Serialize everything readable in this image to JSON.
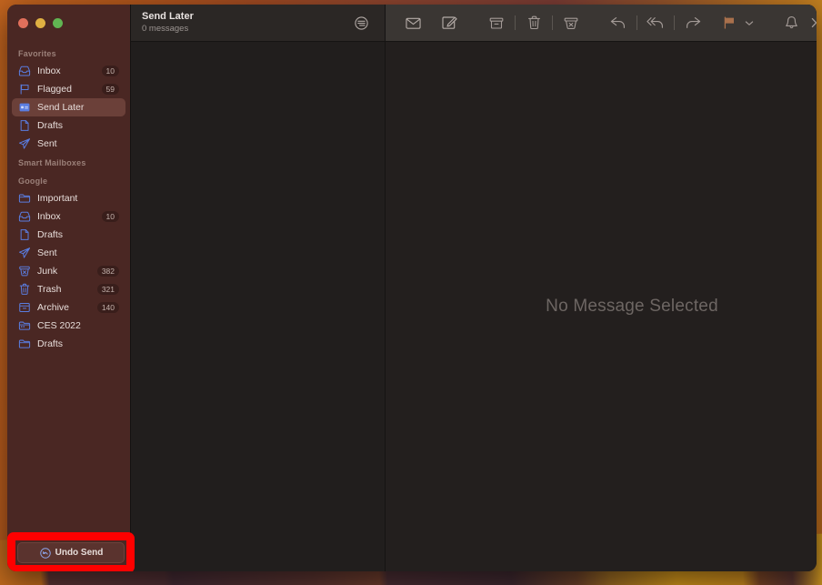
{
  "window": {
    "traffic_lights": [
      "close",
      "minimize",
      "maximize"
    ],
    "colors": {
      "sidebar_bg": "#4a2723",
      "selected_item_bg": "#6b4039",
      "toolbar_bg": "#3a3633",
      "content_bg": "#231f1e",
      "list_bg": "#211e1d",
      "accent_icon": "#5a7de0",
      "flag_orange": "#a9704c",
      "highlight_red": "#fe0000"
    }
  },
  "sidebar": {
    "sections": [
      {
        "header": "Favorites",
        "items": [
          {
            "label": "Inbox",
            "icon": "inbox-icon",
            "badge": "10",
            "selected": false
          },
          {
            "label": "Flagged",
            "icon": "flag-icon",
            "badge": "59",
            "selected": false
          },
          {
            "label": "Send Later",
            "icon": "send-later-icon",
            "badge": "",
            "selected": true
          },
          {
            "label": "Drafts",
            "icon": "document-icon",
            "badge": "",
            "selected": false
          },
          {
            "label": "Sent",
            "icon": "paper-plane-icon",
            "badge": "",
            "selected": false
          }
        ]
      },
      {
        "header": "Smart Mailboxes",
        "items": []
      },
      {
        "header": "Google",
        "items": [
          {
            "label": "Important",
            "icon": "folder-icon",
            "badge": "",
            "selected": false
          },
          {
            "label": "Inbox",
            "icon": "inbox-icon",
            "badge": "10",
            "selected": false
          },
          {
            "label": "Drafts",
            "icon": "document-icon",
            "badge": "",
            "selected": false
          },
          {
            "label": "Sent",
            "icon": "paper-plane-icon",
            "badge": "",
            "selected": false
          },
          {
            "label": "Junk",
            "icon": "junk-icon",
            "badge": "382",
            "selected": false
          },
          {
            "label": "Trash",
            "icon": "trash-icon",
            "badge": "321",
            "selected": false
          },
          {
            "label": "Archive",
            "icon": "archive-icon",
            "badge": "140",
            "selected": false
          },
          {
            "label": "CES 2022",
            "icon": "calendar-folder-icon",
            "badge": "",
            "selected": false
          },
          {
            "label": "Drafts",
            "icon": "folder-icon",
            "badge": "",
            "selected": false
          }
        ]
      }
    ],
    "undo_send": {
      "label": "Undo Send",
      "icon": "undo-circle-icon"
    }
  },
  "message_list": {
    "title": "Send Later",
    "count": "0 messages",
    "filter_icon": "filter-icon"
  },
  "toolbar": {
    "buttons": [
      {
        "name": "mark-unread-button",
        "icon": "envelope-icon"
      },
      {
        "name": "compose-button",
        "icon": "compose-icon"
      },
      {
        "name": "archive-button",
        "icon": "archive-box-icon"
      },
      {
        "name": "delete-button",
        "icon": "trash-icon"
      },
      {
        "name": "junk-button",
        "icon": "junk-bin-icon"
      },
      {
        "name": "reply-button",
        "icon": "reply-arrow-icon"
      },
      {
        "name": "reply-all-button",
        "icon": "reply-all-arrow-icon"
      },
      {
        "name": "forward-button",
        "icon": "forward-arrow-icon"
      },
      {
        "name": "flag-button",
        "icon": "flag-filled-icon"
      },
      {
        "name": "flag-dropdown",
        "icon": "chevron-down-icon"
      },
      {
        "name": "mute-button",
        "icon": "bell-icon"
      },
      {
        "name": "overflow-button",
        "icon": "double-chevron-right-icon"
      },
      {
        "name": "search-button",
        "icon": "magnifier-icon"
      }
    ]
  },
  "content": {
    "empty_state": "No Message Selected"
  }
}
